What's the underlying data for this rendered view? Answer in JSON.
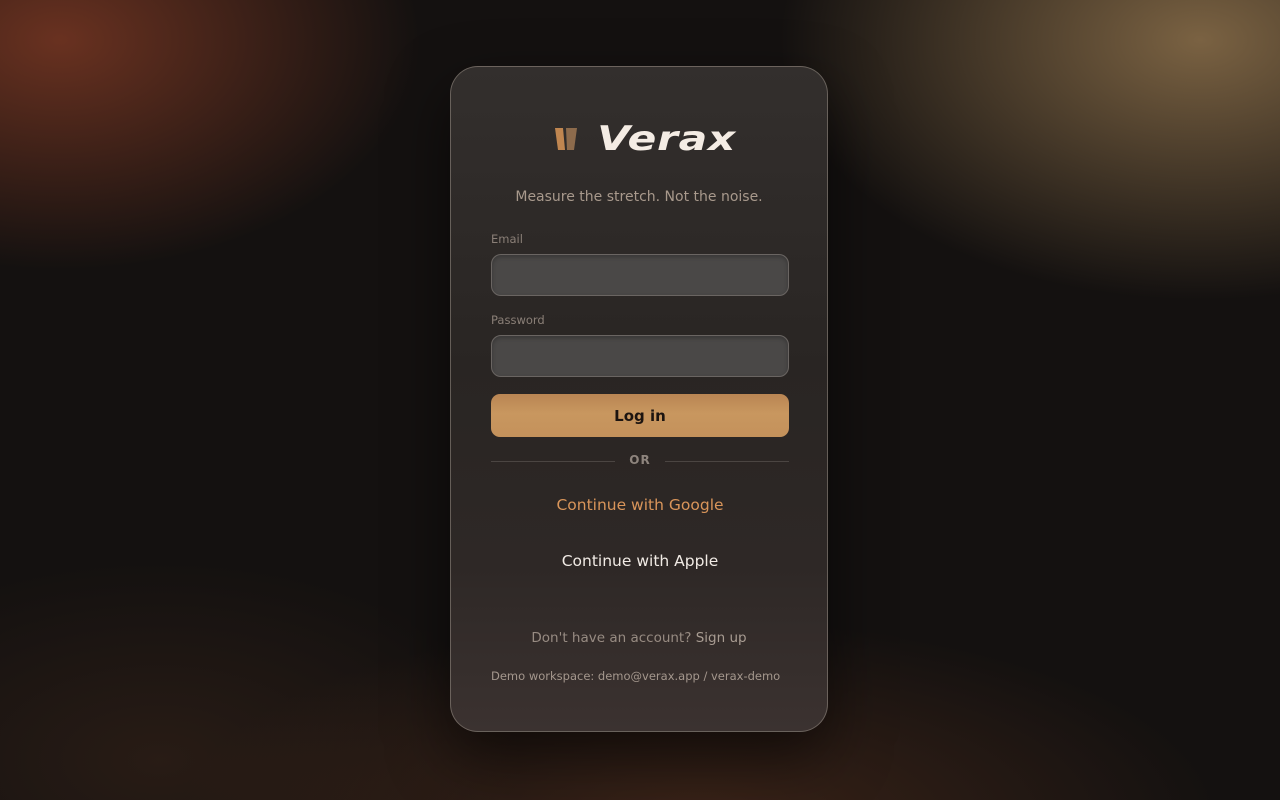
{
  "brand": {
    "name": "Verax",
    "tagline": "Measure the stretch. Not the noise.",
    "logo_icon": "verax-mark-icon",
    "accent_color": "#c8975f"
  },
  "form": {
    "email_label": "Email",
    "email_value": "",
    "email_placeholder": "",
    "password_label": "Password",
    "password_value": "",
    "password_placeholder": "",
    "login_label": "Log in"
  },
  "divider": {
    "label": "OR"
  },
  "social": {
    "google_label": "Continue with Google",
    "apple_label": "Continue with Apple"
  },
  "footer": {
    "signup_prompt": "Don't have an account?",
    "signup_link": "Sign up",
    "demo_note": "Demo workspace: demo@verax.app / verax-demo"
  }
}
